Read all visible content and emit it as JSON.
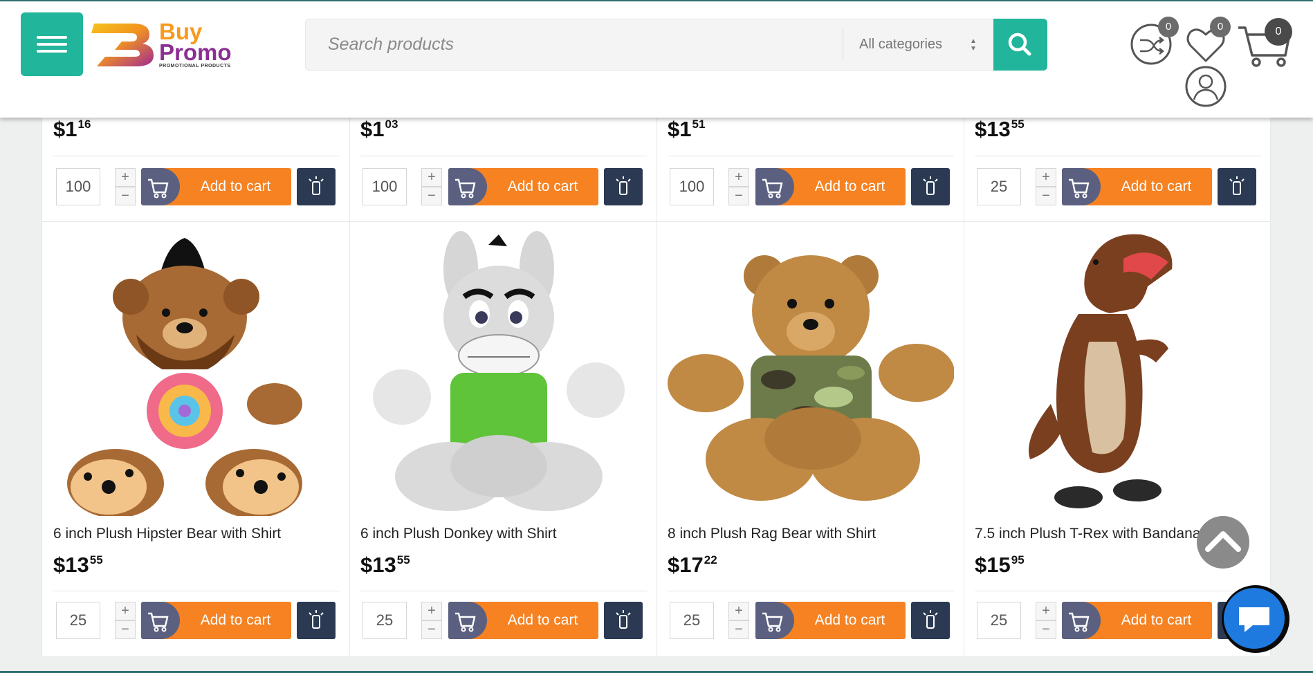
{
  "header": {
    "logo": {
      "line1": "Buy",
      "line2": "Promo",
      "tagline": "PROMOTIONAL PRODUCTS"
    },
    "search": {
      "placeholder": "Search products",
      "category": "All categories"
    },
    "badges": {
      "compare": "0",
      "wishlist": "0",
      "cart": "0"
    }
  },
  "top_row": [
    {
      "price_main": "$1",
      "price_cents": "16",
      "qty": "100",
      "add_label": "Add to cart"
    },
    {
      "price_main": "$1",
      "price_cents": "03",
      "qty": "100",
      "add_label": "Add to cart"
    },
    {
      "price_main": "$1",
      "price_cents": "51",
      "qty": "100",
      "add_label": "Add to cart"
    },
    {
      "price_main": "$13",
      "price_cents": "55",
      "qty": "25",
      "add_label": "Add to cart"
    }
  ],
  "products": [
    {
      "name": "6 inch Plush Hipster Bear with Shirt",
      "price_main": "$13",
      "price_cents": "55",
      "qty": "25",
      "add_label": "Add to cart"
    },
    {
      "name": "6 inch Plush Donkey with Shirt",
      "price_main": "$13",
      "price_cents": "55",
      "qty": "25",
      "add_label": "Add to cart"
    },
    {
      "name": "8 inch Plush Rag Bear with Shirt",
      "price_main": "$17",
      "price_cents": "22",
      "qty": "25",
      "add_label": "Add to cart"
    },
    {
      "name": "7.5 inch Plush T-Rex with Bandana",
      "price_main": "$15",
      "price_cents": "95",
      "qty": "25",
      "add_label": "Add to cart"
    }
  ],
  "stepper": {
    "plus": "+",
    "minus": "−"
  },
  "colors": {
    "teal": "#21b59b",
    "orange": "#f68222",
    "navy": "#2b3a52",
    "slate": "#5b6080",
    "chat_blue": "#1f7ae0"
  },
  "icons": [
    "menu-icon",
    "search-icon",
    "compare-icon",
    "heart-icon",
    "cart-icon",
    "user-icon",
    "add-cart-icon",
    "quote-icon",
    "chevron-up-icon",
    "chat-icon"
  ]
}
